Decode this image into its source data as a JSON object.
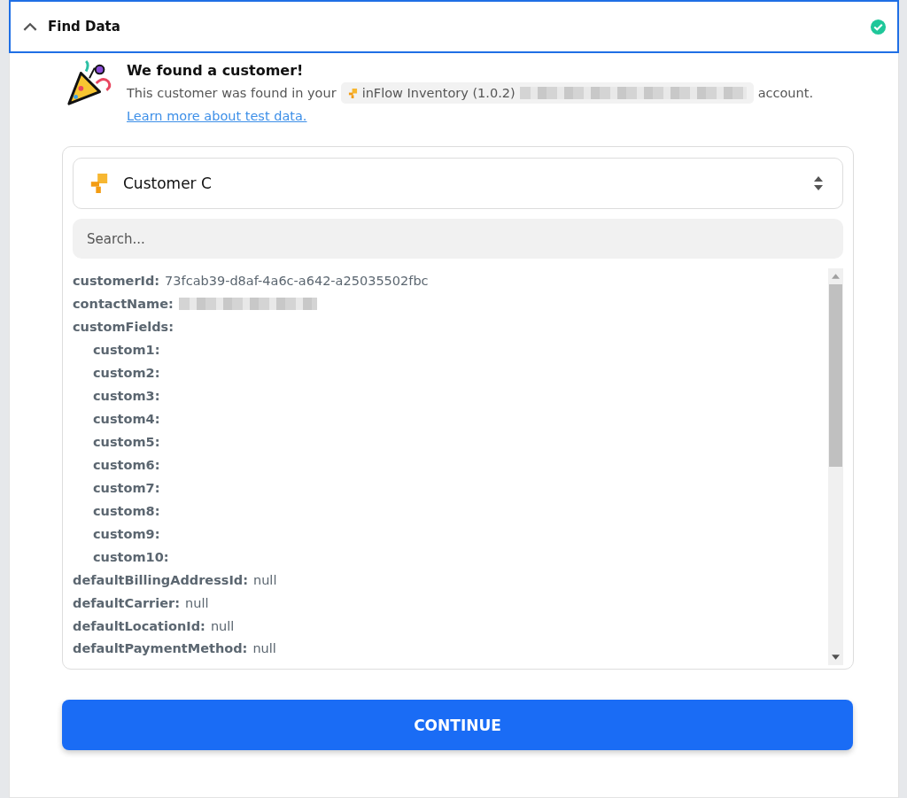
{
  "header": {
    "title": "Find Data",
    "expanded": true,
    "complete": true
  },
  "result": {
    "title": "We found a customer!",
    "message_before": "This customer was found in your",
    "app_name": "inFlow Inventory (1.0.2)",
    "message_after": "account.",
    "link": "Learn more about test data."
  },
  "record_select": {
    "value": "Customer C"
  },
  "search": {
    "placeholder": "Search..."
  },
  "fields": [
    {
      "key": "customerId:",
      "value": "73fcab39-d8af-4a6c-a642-a25035502fbc"
    },
    {
      "key": "contactName:",
      "redacted": true
    },
    {
      "key": "customFields:",
      "children": [
        {
          "key": "custom1:"
        },
        {
          "key": "custom2:"
        },
        {
          "key": "custom3:"
        },
        {
          "key": "custom4:"
        },
        {
          "key": "custom5:"
        },
        {
          "key": "custom6:"
        },
        {
          "key": "custom7:"
        },
        {
          "key": "custom8:"
        },
        {
          "key": "custom9:"
        },
        {
          "key": "custom10:"
        }
      ]
    },
    {
      "key": "defaultBillingAddressId:",
      "value": "null"
    },
    {
      "key": "defaultCarrier:",
      "value": "null"
    },
    {
      "key": "defaultLocationId:",
      "value": "null"
    },
    {
      "key": "defaultPaymentMethod:",
      "value": "null"
    }
  ],
  "continue_button": {
    "label": "CONTINUE"
  }
}
